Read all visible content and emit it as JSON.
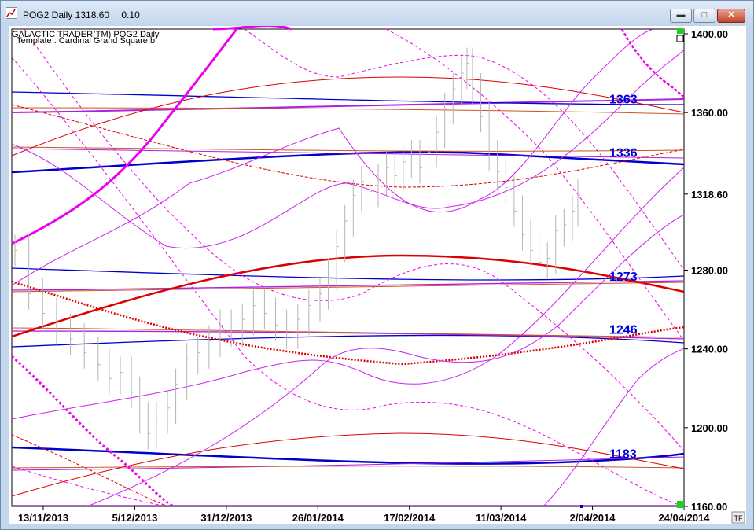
{
  "window": {
    "title": "POG2 Daily 1318.60",
    "title_change": "0.10",
    "controls": {
      "minimize": "▬",
      "maximize": "□",
      "close": "✕"
    }
  },
  "chart_header": {
    "line1": "GALACTIC TRADER(TM)     POG2 Daily",
    "line2": "Template : Cardinal Grand Square b"
  },
  "corner_label": "TF",
  "chart_data": {
    "type": "line",
    "ylim": [
      1160,
      1400
    ],
    "y_ticks": [
      "1400.00",
      "1360.00",
      "1318.60",
      "1280.00",
      "1240.00",
      "1200.00",
      "1160.00"
    ],
    "y_tick_values": [
      1400,
      1360,
      1318.6,
      1280,
      1240,
      1200,
      1160
    ],
    "x_labels": [
      "13/11/2013",
      "5/12/2013",
      "31/12/2013",
      "26/01/2014",
      "17/02/2014",
      "11/03/2014",
      "2/04/2014",
      "24/04/2014"
    ],
    "level_labels": [
      "1363",
      "1336",
      "1273",
      "1246",
      "1183"
    ],
    "level_values": [
      1363,
      1336,
      1273,
      1246,
      1183
    ],
    "colors": {
      "blue": "#0000cc",
      "red": "#dd0000",
      "magenta": "#ee00ee",
      "violet": "#aa22dd",
      "orange": "#cc5522",
      "price": "#b4b4b4",
      "label": "#0000dd"
    },
    "price_series": [
      {
        "x": 0,
        "y": 1290
      },
      {
        "x": 5,
        "y": 1268
      },
      {
        "x": 10,
        "y": 1258
      },
      {
        "x": 15,
        "y": 1250
      },
      {
        "x": 20,
        "y": 1245
      },
      {
        "x": 25,
        "y": 1238
      },
      {
        "x": 30,
        "y": 1232
      },
      {
        "x": 34,
        "y": 1225
      },
      {
        "x": 38,
        "y": 1228
      },
      {
        "x": 42,
        "y": 1218
      },
      {
        "x": 45,
        "y": 1205
      },
      {
        "x": 48,
        "y": 1197
      },
      {
        "x": 51,
        "y": 1205
      },
      {
        "x": 55,
        "y": 1210
      },
      {
        "x": 58,
        "y": 1222
      },
      {
        "x": 62,
        "y": 1235
      },
      {
        "x": 66,
        "y": 1238
      },
      {
        "x": 70,
        "y": 1244
      },
      {
        "x": 74,
        "y": 1252
      },
      {
        "x": 78,
        "y": 1249
      },
      {
        "x": 82,
        "y": 1255
      },
      {
        "x": 86,
        "y": 1262
      },
      {
        "x": 90,
        "y": 1258
      },
      {
        "x": 94,
        "y": 1252
      },
      {
        "x": 98,
        "y": 1248
      },
      {
        "x": 102,
        "y": 1255
      },
      {
        "x": 106,
        "y": 1262
      },
      {
        "x": 110,
        "y": 1268
      },
      {
        "x": 113,
        "y": 1278
      },
      {
        "x": 116,
        "y": 1292
      },
      {
        "x": 119,
        "y": 1305
      },
      {
        "x": 122,
        "y": 1318
      },
      {
        "x": 125,
        "y": 1325
      },
      {
        "x": 128,
        "y": 1320
      },
      {
        "x": 131,
        "y": 1326
      },
      {
        "x": 134,
        "y": 1332
      },
      {
        "x": 137,
        "y": 1328
      },
      {
        "x": 140,
        "y": 1335
      },
      {
        "x": 143,
        "y": 1338
      },
      {
        "x": 146,
        "y": 1332
      },
      {
        "x": 149,
        "y": 1340
      },
      {
        "x": 152,
        "y": 1350
      },
      {
        "x": 155,
        "y": 1362
      },
      {
        "x": 158,
        "y": 1372
      },
      {
        "x": 161,
        "y": 1380
      },
      {
        "x": 163,
        "y": 1385
      },
      {
        "x": 165,
        "y": 1372
      },
      {
        "x": 168,
        "y": 1358
      },
      {
        "x": 171,
        "y": 1338
      },
      {
        "x": 174,
        "y": 1330
      },
      {
        "x": 177,
        "y": 1322
      },
      {
        "x": 180,
        "y": 1310
      },
      {
        "x": 183,
        "y": 1298
      },
      {
        "x": 186,
        "y": 1290
      },
      {
        "x": 189,
        "y": 1284
      },
      {
        "x": 192,
        "y": 1286
      },
      {
        "x": 195,
        "y": 1300
      },
      {
        "x": 198,
        "y": 1303
      },
      {
        "x": 201,
        "y": 1310
      },
      {
        "x": 203,
        "y": 1318
      }
    ]
  }
}
